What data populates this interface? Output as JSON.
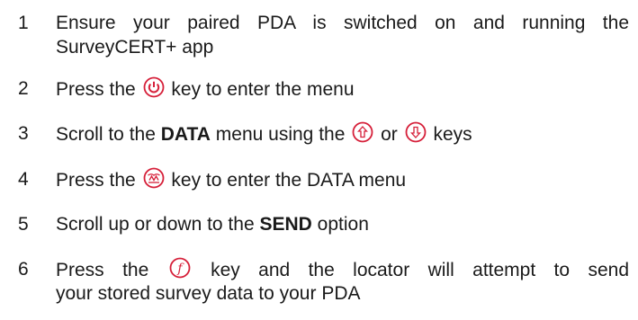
{
  "steps": [
    {
      "num": "1",
      "line1": "Ensure your paired PDA is switched on and running the",
      "line2": "SurveyCERT+ app"
    },
    {
      "num": "2",
      "pre": "Press the",
      "post": "key to enter the menu",
      "icon": "power-key-icon"
    },
    {
      "num": "3",
      "pre": "Scroll to the",
      "bold": "DATA",
      "mid": "menu using the",
      "or": "or",
      "post": "keys",
      "icons": [
        "up-arrow-key-icon",
        "down-arrow-key-icon"
      ]
    },
    {
      "num": "4",
      "pre": "Press the",
      "post": "key to enter the DATA menu",
      "icon": "locate-key-icon"
    },
    {
      "num": "5",
      "pre": "Scroll up or down to the",
      "bold": "SEND",
      "post": "option"
    },
    {
      "num": "6",
      "pre": "Press the",
      "post": "key and the locator will attempt to send",
      "line2": "your stored survey data to your PDA",
      "icon": "function-key-icon"
    }
  ],
  "colors": {
    "text": "#1a1a1a",
    "icon": "#d6203a"
  }
}
